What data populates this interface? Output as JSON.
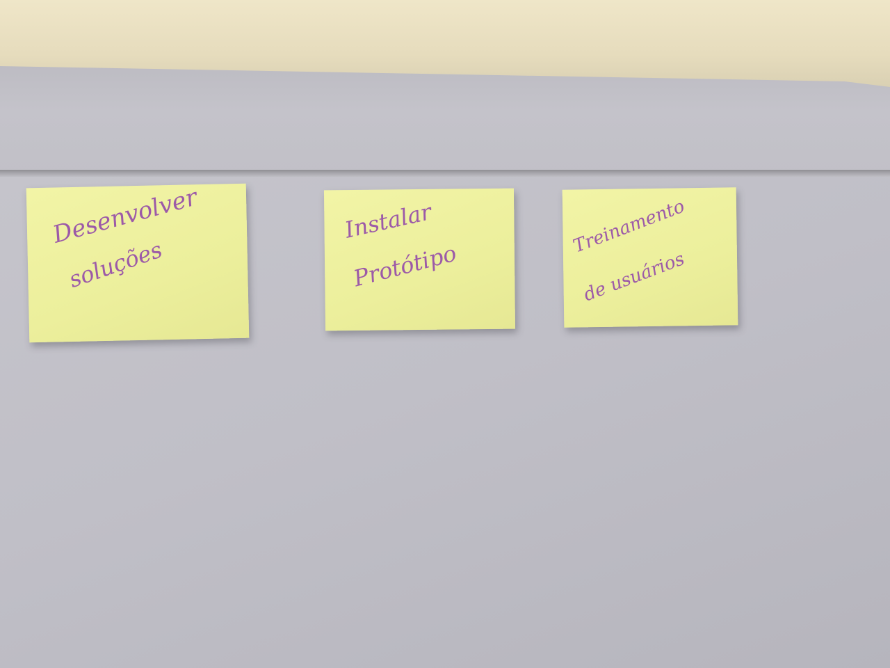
{
  "notes": [
    {
      "line1": "Desenvolver",
      "line2": "soluções"
    },
    {
      "line1": "Instalar",
      "line2": "Protótipo"
    },
    {
      "line1": "Treinamento",
      "line2": "de usuários"
    }
  ],
  "colors": {
    "note": "#ecef9c",
    "ink": "#9c5aa8",
    "panel": "#c2c1c8",
    "wall": "#e8dfc4"
  }
}
